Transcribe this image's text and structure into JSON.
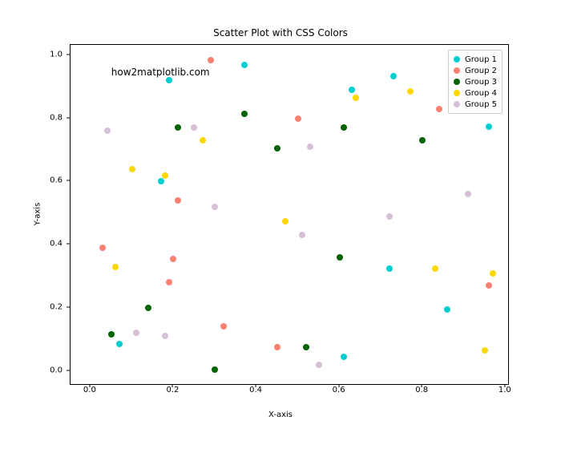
{
  "chart_data": {
    "type": "scatter",
    "title": "Scatter Plot with CSS Colors",
    "xlabel": "X-axis",
    "ylabel": "Y-axis",
    "annotation": "how2matplotlib.com",
    "xlim": [
      -0.048,
      1.01
    ],
    "ylim": [
      -0.047,
      1.033
    ],
    "xticks": [
      0.0,
      0.2,
      0.4,
      0.6,
      0.8,
      1.0
    ],
    "yticks": [
      0.0,
      0.2,
      0.4,
      0.6,
      0.8,
      1.0
    ],
    "colors": {
      "Group 1": "#00CED1",
      "Group 2": "#FA8072",
      "Group 3": "#006400",
      "Group 4": "#FFD700",
      "Group 5": "#D8BFD8"
    },
    "series": [
      {
        "name": "Group 1",
        "color": "#00CED1",
        "points": [
          [
            0.07,
            0.085
          ],
          [
            0.17,
            0.6
          ],
          [
            0.19,
            0.92
          ],
          [
            0.37,
            0.97
          ],
          [
            0.61,
            0.045
          ],
          [
            0.63,
            0.89
          ],
          [
            0.72,
            0.325
          ],
          [
            0.73,
            0.935
          ],
          [
            0.86,
            0.195
          ],
          [
            0.96,
            0.775
          ]
        ]
      },
      {
        "name": "Group 2",
        "color": "#FA8072",
        "points": [
          [
            0.03,
            0.39
          ],
          [
            0.19,
            0.28
          ],
          [
            0.2,
            0.355
          ],
          [
            0.21,
            0.54
          ],
          [
            0.29,
            0.985
          ],
          [
            0.32,
            0.14
          ],
          [
            0.45,
            0.075
          ],
          [
            0.5,
            0.8
          ],
          [
            0.84,
            0.83
          ],
          [
            0.96,
            0.27
          ]
        ]
      },
      {
        "name": "Group 3",
        "color": "#006400",
        "points": [
          [
            0.05,
            0.115
          ],
          [
            0.14,
            0.2
          ],
          [
            0.21,
            0.77
          ],
          [
            0.3,
            0.005
          ],
          [
            0.37,
            0.815
          ],
          [
            0.45,
            0.705
          ],
          [
            0.52,
            0.075
          ],
          [
            0.6,
            0.36
          ],
          [
            0.61,
            0.77
          ],
          [
            0.8,
            0.73
          ]
        ]
      },
      {
        "name": "Group 4",
        "color": "#FFD700",
        "points": [
          [
            0.06,
            0.33
          ],
          [
            0.1,
            0.64
          ],
          [
            0.18,
            0.62
          ],
          [
            0.27,
            0.73
          ],
          [
            0.47,
            0.475
          ],
          [
            0.64,
            0.865
          ],
          [
            0.77,
            0.885
          ],
          [
            0.83,
            0.325
          ],
          [
            0.95,
            0.065
          ],
          [
            0.97,
            0.31
          ]
        ]
      },
      {
        "name": "Group 5",
        "color": "#D8BFD8",
        "points": [
          [
            0.04,
            0.76
          ],
          [
            0.11,
            0.12
          ],
          [
            0.18,
            0.11
          ],
          [
            0.25,
            0.77
          ],
          [
            0.3,
            0.52
          ],
          [
            0.51,
            0.43
          ],
          [
            0.53,
            0.71
          ],
          [
            0.55,
            0.02
          ],
          [
            0.72,
            0.49
          ],
          [
            0.91,
            0.56
          ]
        ]
      }
    ]
  }
}
